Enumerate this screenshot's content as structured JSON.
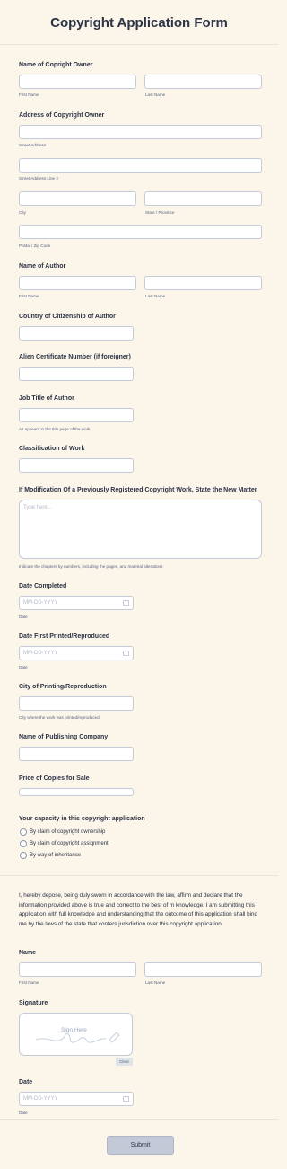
{
  "title": "Copyright Application Form",
  "owner": {
    "label": "Name of Copright Owner",
    "first": "First Name",
    "last": "Last Name"
  },
  "address": {
    "label": "Address of Copyright Owner",
    "street": "Street Address",
    "street2": "Street Address Line 2",
    "city": "City",
    "state": "State / Province",
    "zip": "Postal / Zip Code"
  },
  "author": {
    "label": "Name of Author",
    "first": "First Name",
    "last": "Last Name"
  },
  "citizenship": {
    "label": "Country of Citizenship of Author"
  },
  "alien": {
    "label": "Alien Certificate Number (if foreigner)"
  },
  "job": {
    "label": "Job Title of Author",
    "sub": "As appears in the title page of the work"
  },
  "classification": {
    "label": "Classification of Work"
  },
  "modification": {
    "label": "If Modification Of a Previously Registered Copyright Work, State the New Matter",
    "placeholder": "Type here...",
    "sub": "Indicate the chapters by numbers, including the pages, and material alterations"
  },
  "date_completed": {
    "label": "Date Completed",
    "placeholder": "MM-DD-YYYY",
    "sub": "Date"
  },
  "date_printed": {
    "label": "Date First Printed/Reproduced",
    "placeholder": "MM-DD-YYYY",
    "sub": "Date"
  },
  "city_printing": {
    "label": "City of Printing/Reproduction",
    "sub": "City where the work was printed/reproduced"
  },
  "publisher": {
    "label": "Name of Publishing Company"
  },
  "price": {
    "label": "Price of Copies for Sale"
  },
  "capacity": {
    "label": "Your capacity in this copyright application",
    "options": [
      "By claim of copyright ownership",
      "By claim of copyright assignment",
      "By way of inheritance"
    ]
  },
  "declaration": "I, hereby depose, being duly sworn in accordance with the law, affirm and declare that the information provided above is true and correct to the best of m knowledge. I am submitting this application with full knowledge and understanding that the outcome of this application shall bind me by the laws of the state that confers jurisdiction over this copyright application.",
  "name": {
    "label": "Name",
    "first": "First Name",
    "last": "Last Name"
  },
  "signature": {
    "label": "Signature",
    "placeholder": "Sign Here",
    "clear": "Clear"
  },
  "date": {
    "label": "Date",
    "placeholder": "MM-DD-YYYY",
    "sub": "Date"
  },
  "submit": "Submit",
  "colors": {
    "background": "#fbf5ea",
    "text": "#2c3345",
    "border": "#c3cad8",
    "button": "#c3c9d6"
  }
}
